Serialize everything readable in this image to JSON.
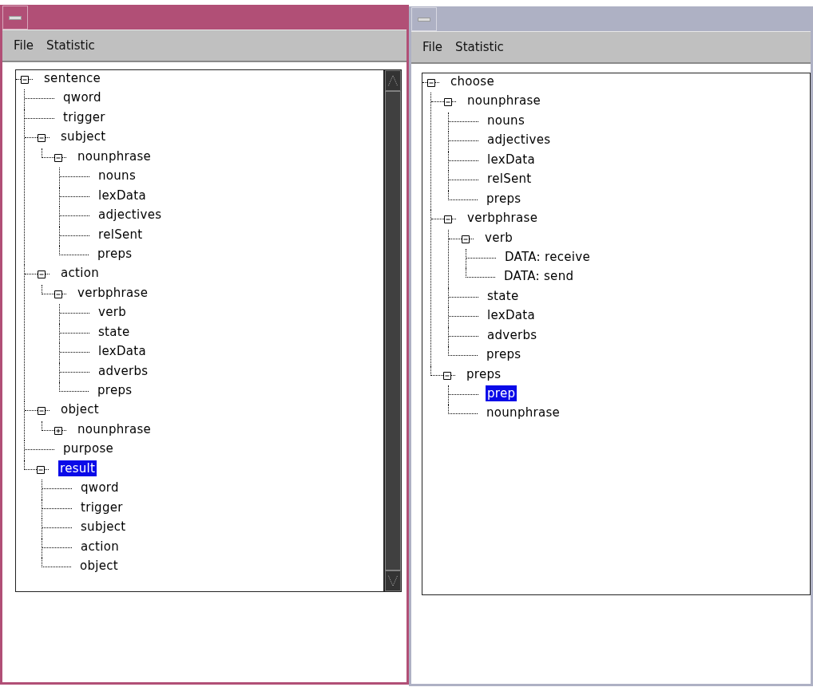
{
  "windows": [
    {
      "active": true,
      "scrollbar": true,
      "menu": [
        "File",
        "Statistic"
      ],
      "tree": [
        {
          "label": "sentence",
          "expanded": true,
          "selected": false,
          "children": [
            {
              "label": "qword",
              "selected": false
            },
            {
              "label": "trigger",
              "selected": false
            },
            {
              "label": "subject",
              "expanded": true,
              "selected": false,
              "children": [
                {
                  "label": "nounphrase",
                  "expanded": true,
                  "selected": false,
                  "children": [
                    {
                      "label": "nouns",
                      "selected": false
                    },
                    {
                      "label": "lexData",
                      "selected": false
                    },
                    {
                      "label": "adjectives",
                      "selected": false
                    },
                    {
                      "label": "relSent",
                      "selected": false
                    },
                    {
                      "label": "preps",
                      "selected": false
                    }
                  ]
                }
              ]
            },
            {
              "label": "action",
              "expanded": true,
              "selected": false,
              "children": [
                {
                  "label": "verbphrase",
                  "expanded": true,
                  "selected": false,
                  "children": [
                    {
                      "label": "verb",
                      "selected": false
                    },
                    {
                      "label": "state",
                      "selected": false
                    },
                    {
                      "label": "lexData",
                      "selected": false
                    },
                    {
                      "label": "adverbs",
                      "selected": false
                    },
                    {
                      "label": "preps",
                      "selected": false
                    }
                  ]
                }
              ]
            },
            {
              "label": "object",
              "expanded": true,
              "selected": false,
              "children": [
                {
                  "label": "nounphrase",
                  "expanded": false,
                  "selected": false
                }
              ]
            },
            {
              "label": "purpose",
              "selected": false
            },
            {
              "label": "result",
              "expanded": true,
              "selected": true,
              "children": [
                {
                  "label": "qword",
                  "selected": false
                },
                {
                  "label": "trigger",
                  "selected": false
                },
                {
                  "label": "subject",
                  "selected": false
                },
                {
                  "label": "action",
                  "selected": false
                },
                {
                  "label": "object",
                  "selected": false
                }
              ]
            }
          ]
        }
      ]
    },
    {
      "active": false,
      "scrollbar": false,
      "menu": [
        "File",
        "Statistic"
      ],
      "tree": [
        {
          "label": "choose",
          "expanded": true,
          "selected": false,
          "children": [
            {
              "label": "nounphrase",
              "expanded": true,
              "selected": false,
              "children": [
                {
                  "label": "nouns",
                  "selected": false
                },
                {
                  "label": "adjectives",
                  "selected": false
                },
                {
                  "label": "lexData",
                  "selected": false
                },
                {
                  "label": "relSent",
                  "selected": false
                },
                {
                  "label": "preps",
                  "selected": false
                }
              ]
            },
            {
              "label": "verbphrase",
              "expanded": true,
              "selected": false,
              "children": [
                {
                  "label": "verb",
                  "expanded": true,
                  "selected": false,
                  "children": [
                    {
                      "label": "DATA: receive",
                      "selected": false
                    },
                    {
                      "label": "DATA: send",
                      "selected": false
                    }
                  ]
                },
                {
                  "label": "state",
                  "selected": false
                },
                {
                  "label": "lexData",
                  "selected": false
                },
                {
                  "label": "adverbs",
                  "selected": false
                },
                {
                  "label": "preps",
                  "selected": false
                }
              ]
            },
            {
              "label": "preps",
              "expanded": true,
              "selected": false,
              "children": [
                {
                  "label": "prep",
                  "selected": true
                },
                {
                  "label": "nounphrase",
                  "selected": false
                }
              ]
            }
          ]
        }
      ]
    }
  ]
}
